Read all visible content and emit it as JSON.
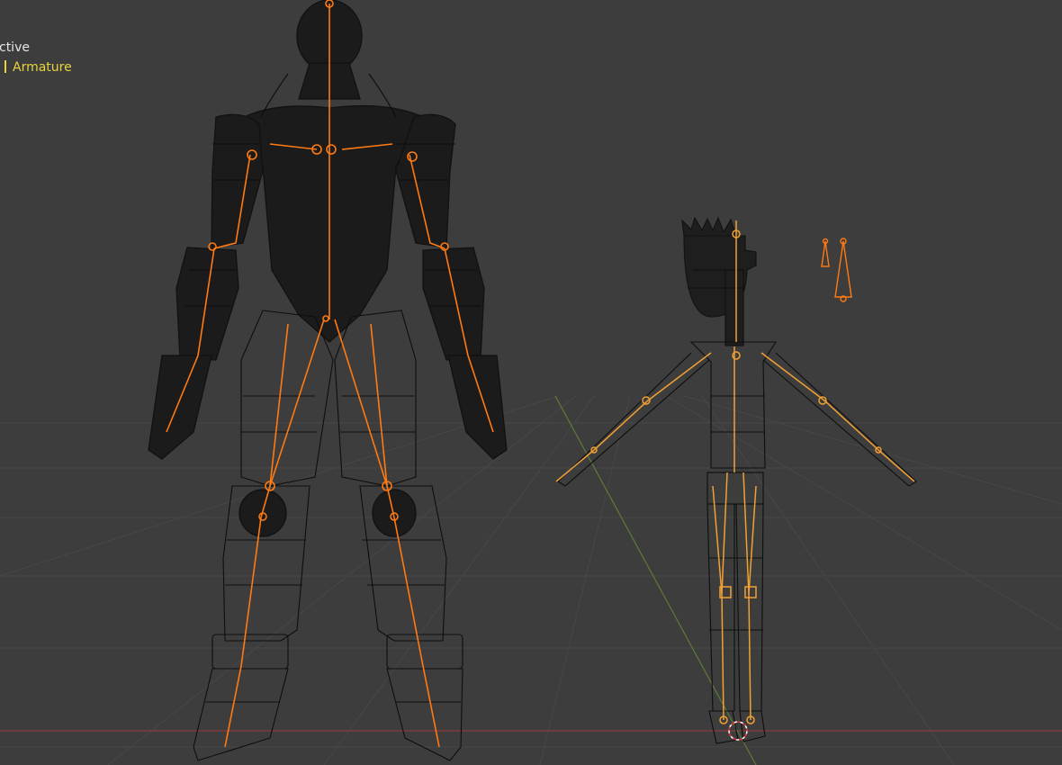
{
  "viewport": {
    "mode_text": "ctive",
    "object_name": "Armature",
    "colors": {
      "background": "#3d3d3d",
      "grid": "#474747",
      "axis_x": "#8a3b3b",
      "axis_y": "#5f7a3a",
      "wire": "#111111",
      "mesh_fill": "#1b1b1b",
      "bone": "#ff7a12",
      "bone_selected": "#f2a033",
      "object_text": "#e8d33c"
    }
  }
}
